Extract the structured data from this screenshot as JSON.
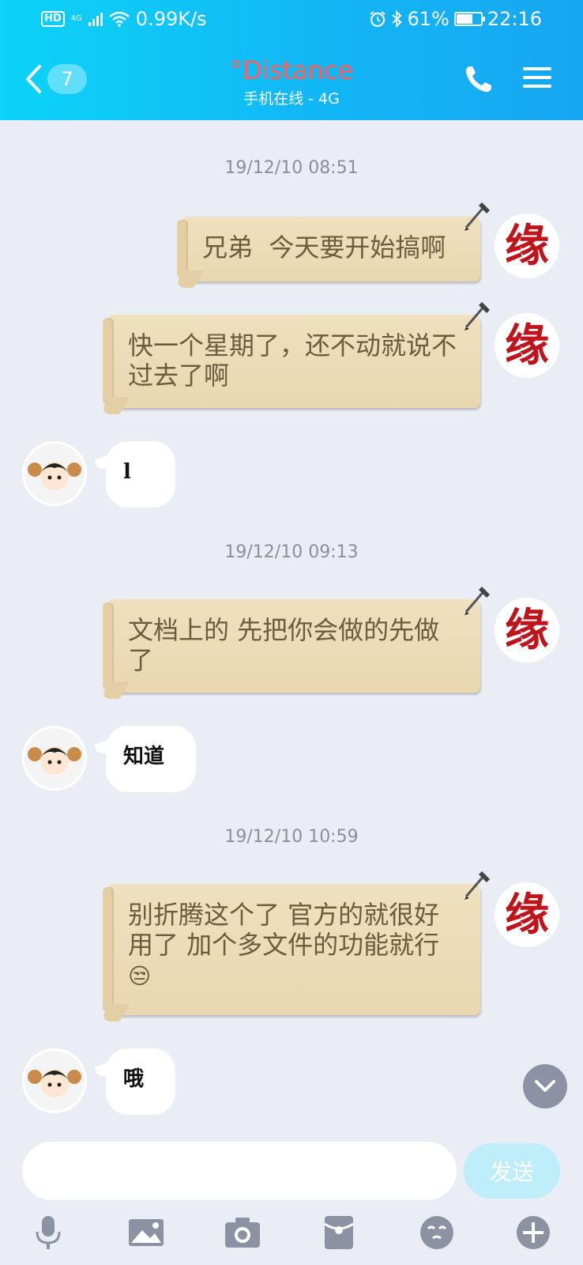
{
  "status_bar": {
    "hd": "HD",
    "network": "4G",
    "speed": "0.99K/s",
    "battery": "61%",
    "time": "22:16"
  },
  "header": {
    "back_count": "7",
    "title": "°Distance",
    "subtitle": "手机在线 - 4G"
  },
  "timestamps": [
    "19/12/10 08:51",
    "19/12/10 09:13",
    "19/12/10 10:59"
  ],
  "messages": [
    {
      "from": "me",
      "text": "兄弟  今天要开始搞啊"
    },
    {
      "from": "me",
      "text": "快一个星期了，还不动就说不过去了啊"
    },
    {
      "from": "other",
      "text": "l"
    },
    {
      "from": "me",
      "text": "文档上的  先把你会做的先做了"
    },
    {
      "from": "other",
      "text": "知道"
    },
    {
      "from": "me",
      "text": "别折腾这个了  官方的就很好用了  加个多文件的功能就行",
      "emoji": "😒"
    },
    {
      "from": "other",
      "text": "哦"
    }
  ],
  "my_avatar_text": "缘",
  "composer": {
    "placeholder": "",
    "send_label": "发送"
  },
  "toolbar": [
    "microphone-icon",
    "image-icon",
    "camera-icon",
    "red-packet-icon",
    "emoji-icon",
    "plus-icon"
  ],
  "colors": {
    "header_start": "#0cd3f8",
    "header_end": "#17a6f2",
    "title": "#ff5e5e",
    "scroll_bg": "#ecdcb8",
    "scroll_text": "#6e5a3c",
    "chat_bg": "#eaedf4"
  }
}
